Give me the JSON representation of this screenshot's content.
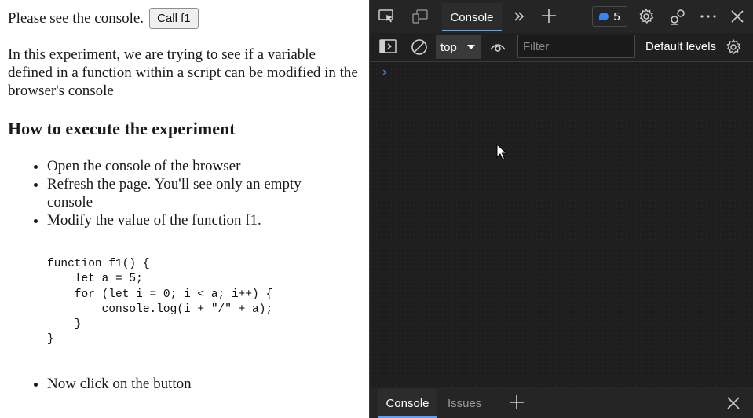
{
  "page": {
    "intro": "Please see the console.",
    "call_button": "Call f1",
    "description": "In this experiment, we are trying to see if a variable defined in a function within a script can be modified in the browser's console",
    "heading": "How to execute the experiment",
    "steps": [
      "Open the console of the browser",
      "Refresh the page. You'll see only an empty console",
      "Modify the value of the function f1."
    ],
    "code": "function f1() {\n    let a = 5;\n    for (let i = 0; i < a; i++) {\n        console.log(i + \"/\" + a);\n    }\n}",
    "final_step": "Now click on the button"
  },
  "devtools": {
    "toolbar": {
      "active_tab": "Console",
      "issues_count": "5"
    },
    "filterbar": {
      "context": "top",
      "filter_placeholder": "Filter",
      "levels": "Default levels"
    },
    "console": {
      "prompt": "›"
    },
    "drawer": {
      "tabs": [
        "Console",
        "Issues"
      ]
    },
    "colors": {
      "background": "#1e1e1e",
      "accent": "#5aa0ff",
      "prompt": "#4d8ef0",
      "issues_badge": "#3a84f0"
    },
    "icons": [
      "inspect-element-icon",
      "device-emulation-icon",
      "more-tabs-icon",
      "new-tab-icon",
      "settings-gear-icon",
      "customize-icon",
      "more-options-icon",
      "close-icon",
      "toggle-sidebar-icon",
      "clear-console-icon",
      "live-expression-eye-icon",
      "console-settings-icon",
      "drawer-add-icon",
      "drawer-close-icon"
    ]
  }
}
